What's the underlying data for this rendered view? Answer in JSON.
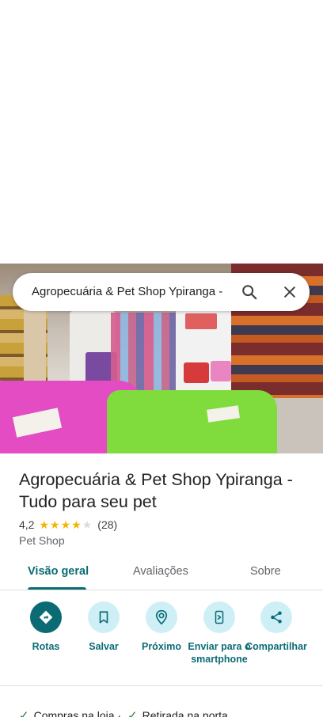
{
  "search": {
    "query": "Agropecuária & Pet Shop Ypiranga -",
    "search_icon": "search-icon",
    "close_icon": "close-icon"
  },
  "place": {
    "title": "Agropecuária & Pet Shop Ypiranga - Tudo para seu pet",
    "rating": "4,2",
    "stars_filled": 4,
    "stars_total": 5,
    "reviews_count": "(28)",
    "category": "Pet Shop"
  },
  "tabs": [
    {
      "label": "Visão geral",
      "active": true
    },
    {
      "label": "Avaliações",
      "active": false
    },
    {
      "label": "Sobre",
      "active": false
    }
  ],
  "actions": [
    {
      "label": "Rotas",
      "icon": "directions-icon"
    },
    {
      "label": "Salvar",
      "icon": "bookmark-icon"
    },
    {
      "label": "Próximo",
      "icon": "nearby-icon"
    },
    {
      "label": "Enviar para o smartphone",
      "icon": "send-to-phone-icon"
    },
    {
      "label": "Compartilhar",
      "icon": "share-icon"
    }
  ],
  "amenities": [
    {
      "label": "Compras na loja ·",
      "icon": "check-icon"
    },
    {
      "label": "Retirada na porta",
      "icon": "check-icon"
    }
  ],
  "colors": {
    "accent": "#0b6b74",
    "accent_light": "#cfeff6",
    "star": "#f4b400",
    "check": "#188038"
  }
}
